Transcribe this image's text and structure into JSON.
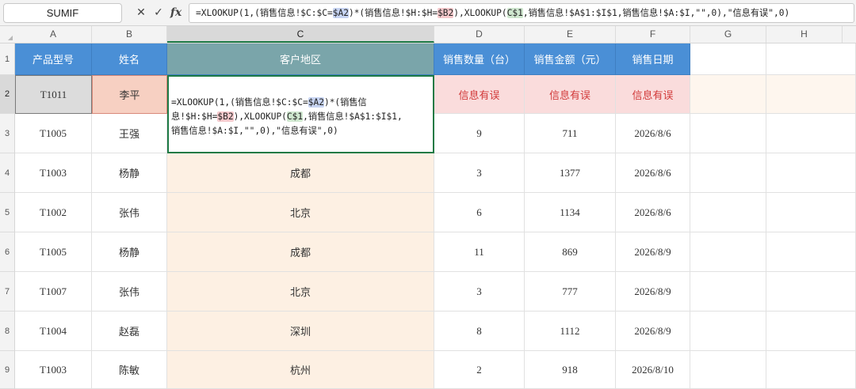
{
  "formula_bar": {
    "name_box": "SUMIF",
    "cancel_icon": "close-icon",
    "confirm_icon": "check-icon",
    "fx_label": "fx",
    "formula_parts": [
      {
        "t": "=XLOOKUP(1,(销售信息!$C:$C=",
        "c": ""
      },
      {
        "t": "$A2",
        "c": "blue"
      },
      {
        "t": ")*(销售信息!$H:$H=",
        "c": ""
      },
      {
        "t": "$B2",
        "c": "red"
      },
      {
        "t": "),XLOOKUP(",
        "c": ""
      },
      {
        "t": "C$1",
        "c": "green"
      },
      {
        "t": ",销售信息!$A$1:$I$1,销售信息!$A:$I,\"\",0),\"信息有误\",0)",
        "c": ""
      }
    ]
  },
  "columns": [
    "A",
    "B",
    "C",
    "D",
    "E",
    "F",
    "G",
    "H"
  ],
  "rows": [
    "1",
    "2",
    "3",
    "4",
    "5",
    "6",
    "7",
    "8",
    "9"
  ],
  "header": {
    "a": "产品型号",
    "b": "姓名",
    "c": "客户地区",
    "d": "销售数量（台）",
    "e": "销售金额（元）",
    "f": "销售日期"
  },
  "row2": {
    "a": "T1011",
    "b": "李平",
    "d": "信息有误",
    "e": "信息有误",
    "f": "信息有误",
    "edit_lines": [
      [
        {
          "t": "=XLOOKUP(1,(销售信息!$C:$C=",
          "c": ""
        },
        {
          "t": "$A2",
          "c": "blue"
        },
        {
          "t": ")*(销售信",
          "c": ""
        }
      ],
      [
        {
          "t": "息!$H:$H=",
          "c": ""
        },
        {
          "t": "$B2",
          "c": "red"
        },
        {
          "t": "),XLOOKUP(",
          "c": ""
        },
        {
          "t": "C$1",
          "c": "green"
        },
        {
          "t": ",销售信息!$A$1:$I$1,",
          "c": ""
        }
      ],
      [
        {
          "t": "销售信息!$A:$I,\"\",0),\"信息有误\",0)",
          "c": ""
        }
      ]
    ]
  },
  "data_rows": [
    {
      "a": "T1005",
      "b": "王强",
      "c": "",
      "d": "9",
      "e": "711",
      "f": "2026/8/6"
    },
    {
      "a": "T1003",
      "b": "杨静",
      "c": "成都",
      "d": "3",
      "e": "1377",
      "f": "2026/8/6"
    },
    {
      "a": "T1002",
      "b": "张伟",
      "c": "北京",
      "d": "6",
      "e": "1134",
      "f": "2026/8/6"
    },
    {
      "a": "T1005",
      "b": "杨静",
      "c": "成都",
      "d": "11",
      "e": "869",
      "f": "2026/8/9"
    },
    {
      "a": "T1007",
      "b": "张伟",
      "c": "北京",
      "d": "3",
      "e": "777",
      "f": "2026/8/9"
    },
    {
      "a": "T1004",
      "b": "赵磊",
      "c": "深圳",
      "d": "8",
      "e": "1112",
      "f": "2026/8/9"
    },
    {
      "a": "T1003",
      "b": "陈敏",
      "c": "杭州",
      "d": "2",
      "e": "918",
      "f": "2026/8/10"
    }
  ],
  "colors": {
    "header_blue": "#4a8fd6",
    "header_teal": "#7aa5aa",
    "error_fill": "#fadcdc",
    "error_text": "#d23a3a",
    "peach_fill": "#fdf0e3",
    "selection_green": "#1d7a45"
  }
}
